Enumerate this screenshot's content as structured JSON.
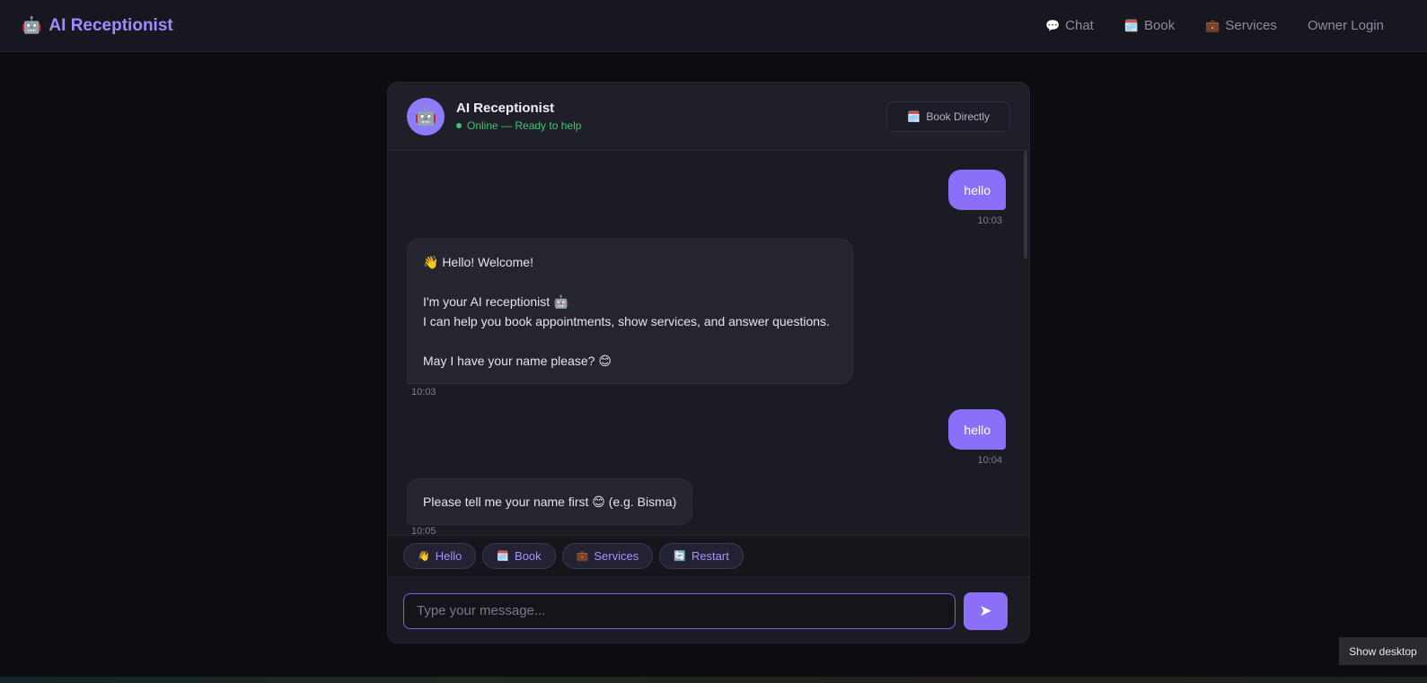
{
  "nav": {
    "brand": "AI Receptionist",
    "brand_icon": "🤖",
    "links": [
      {
        "icon": "💬",
        "label": "Chat"
      },
      {
        "icon": "🗓️",
        "label": "Book"
      },
      {
        "icon": "💼",
        "label": "Services"
      },
      {
        "icon": "",
        "label": "Owner Login"
      }
    ]
  },
  "chat": {
    "title": "AI Receptionist",
    "avatar_icon": "🤖",
    "status": "Online — Ready to help",
    "book_directly_icon": "🗓️",
    "book_directly": "Book Directly",
    "messages": [
      {
        "role": "user",
        "text": "hello",
        "time": "10:03"
      },
      {
        "role": "bot",
        "lines": [
          "👋 Hello! Welcome!",
          "",
          "I'm your AI receptionist 🤖",
          "I can help you book appointments, show services, and answer questions.",
          "",
          "May I have your name please? 😊"
        ],
        "time": "10:03"
      },
      {
        "role": "user",
        "text": "hello",
        "time": "10:04"
      },
      {
        "role": "bot",
        "lines": [
          "Please tell me your name first 😊 (e.g. Bisma)"
        ],
        "time": "10:05"
      }
    ],
    "quick_replies": [
      {
        "icon": "👋",
        "label": "Hello"
      },
      {
        "icon": "🗓️",
        "label": "Book"
      },
      {
        "icon": "💼",
        "label": "Services"
      },
      {
        "icon": "🔄",
        "label": "Restart"
      }
    ],
    "input_placeholder": "Type your message...",
    "send_icon": "➤"
  },
  "os": {
    "show_desktop": "Show desktop"
  },
  "colors": {
    "accent": "#8b6ff8",
    "brand": "#a08bff",
    "online": "#3ec473",
    "background": "#0d0d11"
  }
}
